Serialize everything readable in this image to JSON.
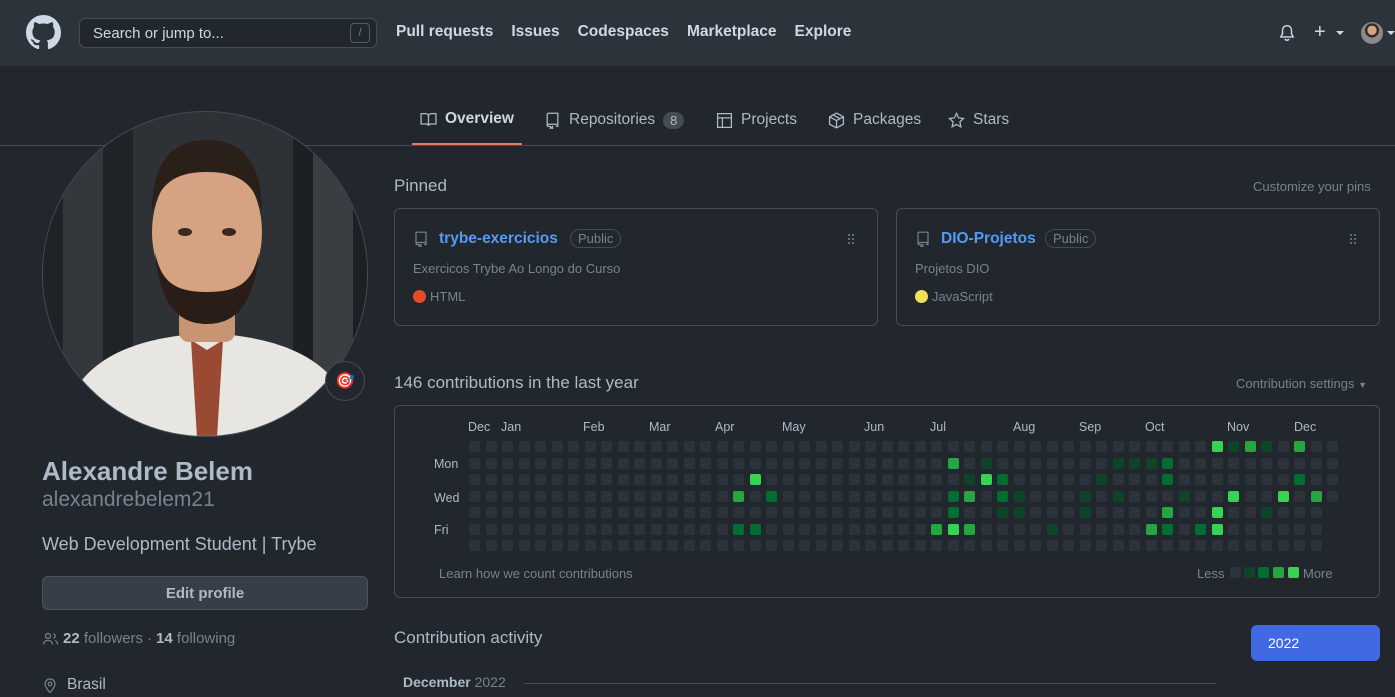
{
  "header": {
    "search_placeholder": "Search or jump to...",
    "search_shortcut": "/",
    "nav": [
      "Pull requests",
      "Issues",
      "Codespaces",
      "Marketplace",
      "Explore"
    ],
    "new_label": "+"
  },
  "tabs": [
    {
      "label": "Overview",
      "active": true,
      "icon": "book-icon"
    },
    {
      "label": "Repositories",
      "count": "8",
      "icon": "repo-icon"
    },
    {
      "label": "Projects",
      "icon": "table-icon"
    },
    {
      "label": "Packages",
      "icon": "package-icon"
    },
    {
      "label": "Stars",
      "icon": "star-icon"
    }
  ],
  "profile": {
    "name": "Alexandre Belem",
    "login": "alexandrebelem21",
    "bio": "Web Development Student | Trybe",
    "edit_label": "Edit profile",
    "followers_count": "22",
    "followers_label": "followers",
    "separator": "·",
    "following_count": "14",
    "following_label": "following",
    "location": "Brasil",
    "status_emoji": "🎯"
  },
  "pinned": {
    "title": "Pinned",
    "customize": "Customize your pins",
    "items": [
      {
        "name": "trybe-exercicios",
        "visibility": "Public",
        "description": "Exercicos Trybe Ao Longo do Curso",
        "language": "HTML",
        "language_color": "#e34c26"
      },
      {
        "name": "DIO-Projetos",
        "visibility": "Public",
        "description": "Projetos DIO",
        "language": "JavaScript",
        "language_color": "#f1e05a"
      }
    ]
  },
  "contributions": {
    "title": "146 contributions in the last year",
    "settings": "Contribution settings",
    "months": [
      "Dec",
      "Jan",
      "Feb",
      "Mar",
      "Apr",
      "May",
      "Jun",
      "Jul",
      "Aug",
      "Sep",
      "Oct",
      "Nov",
      "Dec"
    ],
    "days": [
      "Mon",
      "Wed",
      "Fri"
    ],
    "learn": "Learn how we count contributions",
    "less": "Less",
    "more": "More",
    "colors": [
      "#2d333b",
      "#0e4429",
      "#006d32",
      "#26a641",
      "#39d353"
    ]
  },
  "activity": {
    "title": "Contribution activity",
    "year": "2022",
    "month_label": "December",
    "month_year": "2022"
  }
}
